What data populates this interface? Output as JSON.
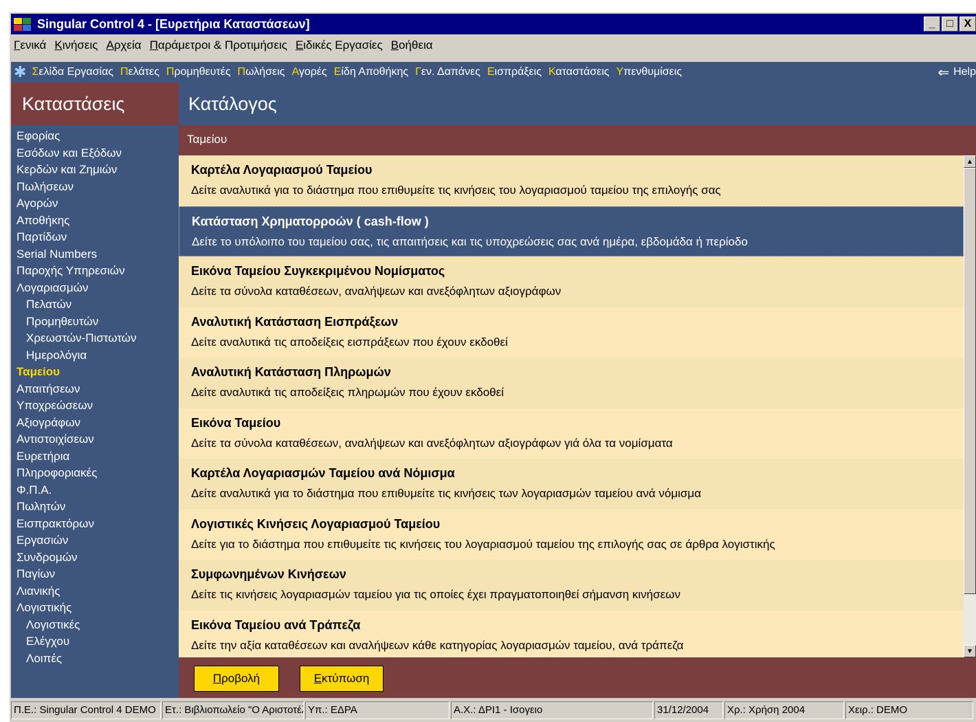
{
  "window": {
    "title": "Singular Control 4 - [Ευρετήρια Καταστάσεων]",
    "controls": [
      "_",
      "□",
      "X"
    ]
  },
  "menu": [
    "Γενικά",
    "Κινήσεις",
    "Αρχεία",
    "Παράμετροι & Προτιμήσεις",
    "Ειδικές Εργασίες",
    "Βοήθεια"
  ],
  "nav": {
    "items": [
      {
        "first": "Σ",
        "rest": "ελίδα Εργασίας"
      },
      {
        "first": "Π",
        "rest": "ελάτες"
      },
      {
        "first": "Π",
        "rest": "ρομηθευτές"
      },
      {
        "first": "Π",
        "rest": "ωλήσεις"
      },
      {
        "first": "Α",
        "rest": "γορές"
      },
      {
        "first": "Ε",
        "rest": "ίδη Αποθήκης"
      },
      {
        "first": "Γ",
        "rest": "εν. Δαπάνες"
      },
      {
        "first": "Ε",
        "rest": "ισπράξεις"
      },
      {
        "first": "Κ",
        "rest": "αταστάσεις"
      },
      {
        "first": "Υ",
        "rest": "πενθυμίσεις"
      }
    ],
    "help": "Help"
  },
  "sidebar": {
    "title": "Καταστάσεις",
    "items": [
      {
        "label": "Εφορίας",
        "level": 0
      },
      {
        "label": "Εσόδων και Εξόδων",
        "level": 0
      },
      {
        "label": "Κερδών και Ζημιών",
        "level": 0
      },
      {
        "label": "Πωλήσεων",
        "level": 0
      },
      {
        "label": "Αγορών",
        "level": 0
      },
      {
        "label": "Αποθήκης",
        "level": 0
      },
      {
        "label": "Παρτίδων",
        "level": 0
      },
      {
        "label": "Serial Numbers",
        "level": 0
      },
      {
        "label": "Παροχής Υπηρεσιών",
        "level": 0
      },
      {
        "label": "Λογαριασμών",
        "level": 0
      },
      {
        "label": "Πελατών",
        "level": 1
      },
      {
        "label": "Προμηθευτών",
        "level": 1
      },
      {
        "label": "Χρεωστών-Πιστωτών",
        "level": 1
      },
      {
        "label": "Ημερολόγια",
        "level": 1
      },
      {
        "label": "Ταμείου",
        "level": 0,
        "active": true
      },
      {
        "label": "Απαιτήσεων",
        "level": 0
      },
      {
        "label": "Υποχρεώσεων",
        "level": 0
      },
      {
        "label": "Αξιογράφων",
        "level": 0
      },
      {
        "label": "Αντιστοιχίσεων",
        "level": 0
      },
      {
        "label": "Ευρετήρια",
        "level": 0
      },
      {
        "label": "Πληροφοριακές",
        "level": 0
      },
      {
        "label": "Φ.Π.Α.",
        "level": 0
      },
      {
        "label": "Πωλητών",
        "level": 0
      },
      {
        "label": "Εισπρακτόρων",
        "level": 0
      },
      {
        "label": "Εργασιών",
        "level": 0
      },
      {
        "label": "Συνδρομών",
        "level": 0
      },
      {
        "label": "Παγίων",
        "level": 0
      },
      {
        "label": "Λιανικής",
        "level": 0
      },
      {
        "label": "Λογιστικής",
        "level": 0
      },
      {
        "label": "Λογιστικές",
        "level": 1
      },
      {
        "label": "Ελέγχου",
        "level": 1
      },
      {
        "label": "Λοιπές",
        "level": 1
      }
    ]
  },
  "main": {
    "title": "Κατάλογος",
    "section": "Ταμείου",
    "reports": [
      {
        "title": "Καρτέλα Λογαριασμού Ταμείου",
        "desc": "Δείτε αναλυτικά για το διάστημα που επιθυμείτε τις κινήσεις του λογαριασμού ταμείου της επιλογής σας"
      },
      {
        "title": "Κατάσταση Χρηματορροών ( cash-flow )",
        "desc": "Δείτε το υπόλοιπο του ταμείου σας, τις απαιτήσεις και τις υποχρεώσεις σας ανά ημέρα, εβδομάδα ή περίοδο",
        "selected": true
      },
      {
        "title": "Εικόνα Ταμείου Συγκεκριμένου Νομίσματος",
        "desc": "Δείτε τα σύνολα καταθέσεων, αναλήψεων και ανεξόφλητων αξιογράφων"
      },
      {
        "title": "Αναλυτική Κατάσταση Εισπράξεων",
        "desc": "Δείτε αναλυτικά τις αποδείξεις εισπράξεων που έχουν εκδοθεί"
      },
      {
        "title": "Αναλυτική Κατάσταση Πληρωμών",
        "desc": "Δείτε αναλυτικά τις αποδείξεις πληρωμών που έχουν εκδοθεί"
      },
      {
        "title": "Εικόνα Ταμείου",
        "desc": "Δείτε τα σύνολα καταθέσεων, αναλήψεων και ανεξόφλητων αξιογράφων γιά όλα τα νομίσματα"
      },
      {
        "title": "Καρτέλα Λογαριασμών Ταμείου ανά Νόμισμα",
        "desc": "Δείτε αναλυτικά για το διάστημα που επιθυμείτε τις κινήσεις των λογαριασμών ταμείου ανά νόμισμα"
      },
      {
        "title": "Λογιστικές Κινήσεις Λογαριασμού Ταμείου",
        "desc": "Δείτε για το διάστημα που επιθυμείτε τις κινήσεις του λογαριασμού ταμείου της επιλογής σας σε άρθρα λογιστικής"
      },
      {
        "title": "Συμφωνημένων Κινήσεων",
        "desc": "Δείτε τις κινήσεις λογαριασμών ταμείου για τις οποίες έχει πραγματοποιηθεί σήμανση κινήσεων"
      },
      {
        "title": "Εικόνα Ταμείου ανά Τράπεζα",
        "desc": "Δείτε την αξία καταθέσεων και αναλήψεων κάθε κατηγορίας λογαριασμών ταμείου,  ανά τράπεζα"
      }
    ],
    "view_button": "Προβολή",
    "print_button": "Εκτύπωση"
  },
  "status": [
    {
      "text": "Π.Ε.: Singular Control 4 DEMO",
      "width": 218
    },
    {
      "text": "Ετ.: Βιβλιοπωλείο \"Ο Αριστοτέλης\"",
      "width": 206
    },
    {
      "text": "Υπ.: ΕΔΡΑ",
      "width": 210
    },
    {
      "text": "Α.Χ.: ΔΡΙ1 - Ισογειο",
      "width": 294
    },
    {
      "text": "31/12/2004",
      "width": 100
    },
    {
      "text": "Χρ.: Χρήση 2004",
      "width": 174
    },
    {
      "text": "Χειρ.: DEMO",
      "width": 186
    }
  ],
  "colors": {
    "title_bar": "#000080",
    "panel_blue": "#3e557d",
    "panel_maroon": "#7a3e3e",
    "accent_yellow": "#ffd700",
    "list_bg": "#f5e3b3"
  }
}
